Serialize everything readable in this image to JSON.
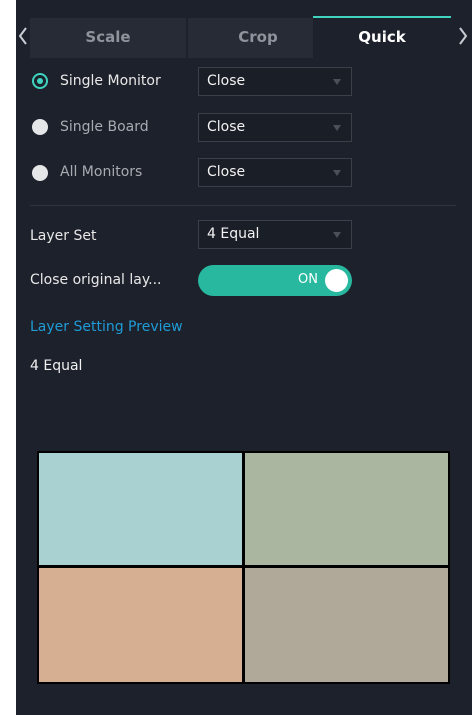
{
  "tabs": [
    {
      "label": "Scale"
    },
    {
      "label": "Crop"
    },
    {
      "label": "Quick"
    }
  ],
  "quick": {
    "rows": [
      {
        "label": "Single Monitor",
        "selected": true,
        "value": "Close"
      },
      {
        "label": "Single Board",
        "selected": false,
        "value": "Close"
      },
      {
        "label": "All Monitors",
        "selected": false,
        "value": "Close"
      }
    ],
    "layer_set": {
      "label": "Layer Set",
      "value": "4 Equal"
    },
    "close_original": {
      "label": "Close original lay...",
      "toggle_text": "ON",
      "on": true
    },
    "preview_title": "Layer Setting Preview",
    "preview_layout_name": "4 Equal",
    "preview_cells": [
      {
        "color": "#a9d1d2"
      },
      {
        "color": "#aab6a0"
      },
      {
        "color": "#d6ae92"
      },
      {
        "color": "#b0a898"
      }
    ]
  },
  "colors": {
    "panel_bg": "#1d212b",
    "accent": "#3fd4c0",
    "toggle_on": "#27b89f",
    "link_blue": "#1f9bd7"
  }
}
